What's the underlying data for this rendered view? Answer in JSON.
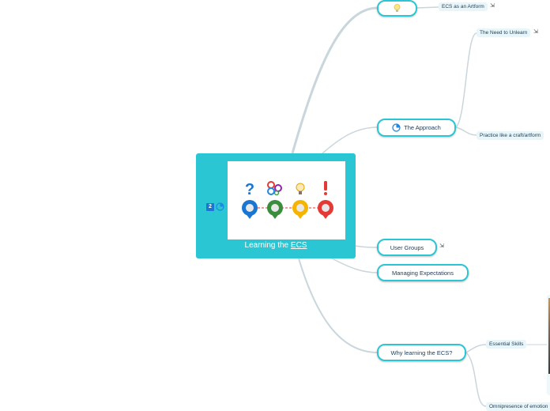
{
  "colors": {
    "accent": "#2bc6d3",
    "link": "#c9d6dc",
    "leaf_bg": "#e9f6f9",
    "text": "#1f3b57"
  },
  "root": {
    "title_prefix": "Learning the ",
    "title_link": "ECS",
    "badge_number": "2",
    "badge_icon": "progress-clock-icon",
    "image_icons": [
      "question-mark",
      "gears",
      "lightbulb",
      "exclamation-mark"
    ]
  },
  "branches": [
    {
      "label": "",
      "icon": "lightbulb-icon",
      "children": [
        {
          "label": "ECS as an Artform",
          "has_link": true
        }
      ]
    },
    {
      "label": "The Approach",
      "icon": "progress-clock-icon",
      "children": [
        {
          "label": "The Need to Unlearn",
          "has_link": true
        },
        {
          "label": "Practice like a craft/artform",
          "has_link": false
        }
      ]
    },
    {
      "label": "User Groups",
      "has_link": true,
      "children": []
    },
    {
      "label": "Managing Expectations",
      "children": []
    },
    {
      "label": "Why learning the ECS?",
      "children": [
        {
          "label": "Essential Skills"
        },
        {
          "label": "Omnipresence of emotion"
        }
      ]
    }
  ]
}
